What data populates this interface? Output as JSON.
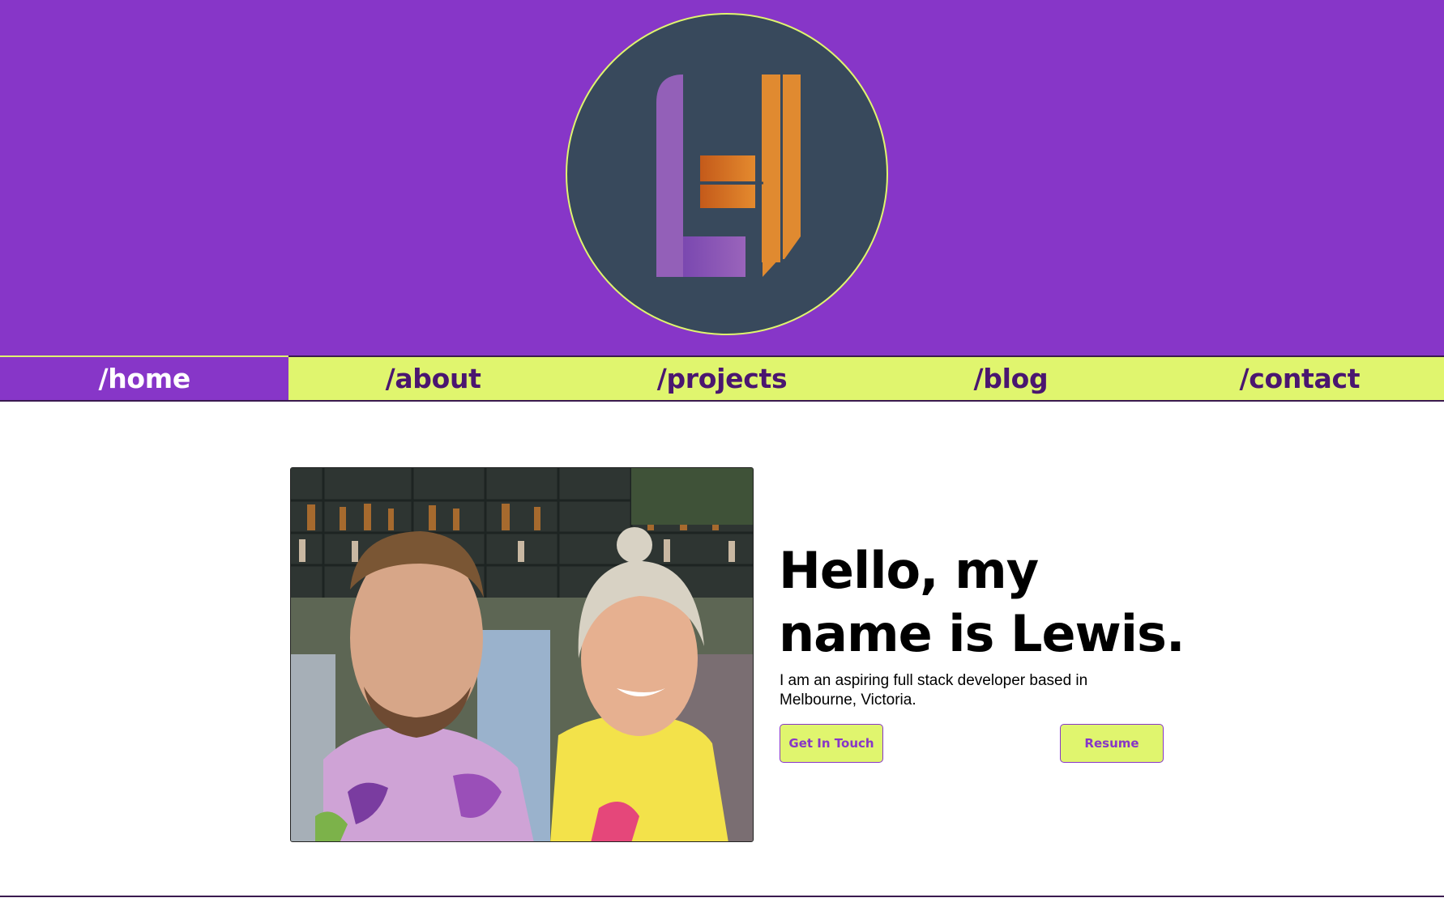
{
  "header": {
    "logo_icon": "monogram-h-logo",
    "colors": {
      "header_bg": "#8736c8",
      "logo_circle": "#38495c",
      "accent": "#e0f56e",
      "logo_purple": "#9360b8",
      "logo_orange": "#e08a30"
    }
  },
  "nav": {
    "items": [
      {
        "label": "/home",
        "active": true
      },
      {
        "label": "/about",
        "active": false
      },
      {
        "label": "/projects",
        "active": false
      },
      {
        "label": "/blog",
        "active": false
      },
      {
        "label": "/contact",
        "active": false
      }
    ]
  },
  "hero": {
    "photo_icon": "profile-photo",
    "title": "Hello, my name is Lewis.",
    "description": "I am an aspiring full stack developer based in Melbourne, Victoria.",
    "buttons": {
      "contact_label": "Get In Touch",
      "resume_label": "Resume"
    }
  }
}
